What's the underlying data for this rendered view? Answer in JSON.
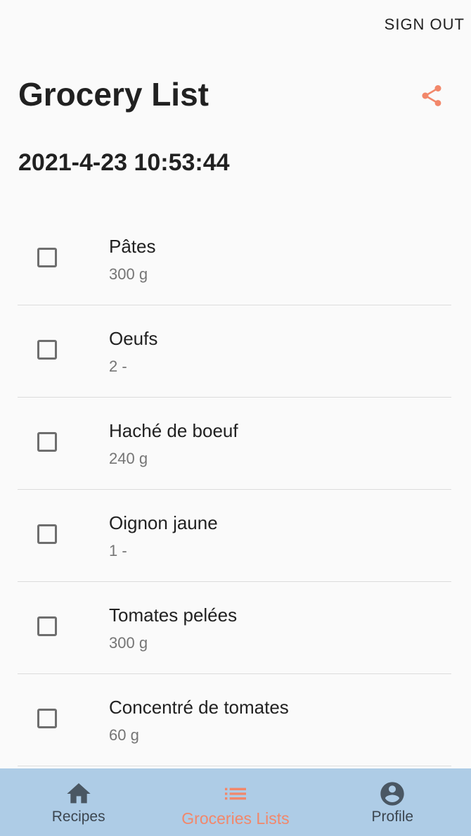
{
  "header": {
    "sign_out_label": "SIGN OUT",
    "title": "Grocery List",
    "datetime": "2021-4-23 10:53:44",
    "share_icon": "share-icon"
  },
  "groceries": [
    {
      "name": "Pâtes",
      "quantity": "300 g",
      "checked": false
    },
    {
      "name": "Oeufs",
      "quantity": "2 -",
      "checked": false
    },
    {
      "name": "Haché de boeuf",
      "quantity": "240 g",
      "checked": false
    },
    {
      "name": "Oignon jaune",
      "quantity": "1 -",
      "checked": false
    },
    {
      "name": "Tomates pelées",
      "quantity": "300 g",
      "checked": false
    },
    {
      "name": "Concentré de tomates",
      "quantity": "60 g",
      "checked": false
    }
  ],
  "bottom_nav": {
    "items": [
      {
        "label": "Recipes",
        "icon": "home-icon",
        "active": false
      },
      {
        "label": "Groceries Lists",
        "icon": "list-icon",
        "active": true
      },
      {
        "label": "Profile",
        "icon": "account-circle-icon",
        "active": false
      }
    ]
  },
  "colors": {
    "accent": "#f2876a",
    "nav_background": "#aecce6",
    "background": "#fafafa",
    "nav_icon": "#4a5763"
  }
}
